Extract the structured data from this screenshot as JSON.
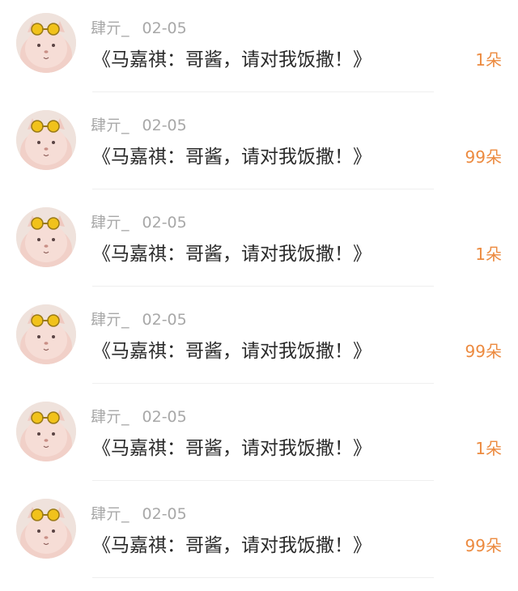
{
  "comments": [
    {
      "author": "肆亓_",
      "date": "02-05",
      "text": "《马嘉祺：哥酱，请对我饭撒！》",
      "flowers": "1朵",
      "avatar_icon": "cat-with-sunglasses-avatar"
    },
    {
      "author": "肆亓_",
      "date": "02-05",
      "text": "《马嘉祺：哥酱，请对我饭撒！》",
      "flowers": "99朵",
      "avatar_icon": "cat-with-sunglasses-avatar"
    },
    {
      "author": "肆亓_",
      "date": "02-05",
      "text": "《马嘉祺：哥酱，请对我饭撒！》",
      "flowers": "1朵",
      "avatar_icon": "cat-with-sunglasses-avatar"
    },
    {
      "author": "肆亓_",
      "date": "02-05",
      "text": "《马嘉祺：哥酱，请对我饭撒！》",
      "flowers": "99朵",
      "avatar_icon": "cat-with-sunglasses-avatar"
    },
    {
      "author": "肆亓_",
      "date": "02-05",
      "text": "《马嘉祺：哥酱，请对我饭撒！》",
      "flowers": "1朵",
      "avatar_icon": "cat-with-sunglasses-avatar"
    },
    {
      "author": "肆亓_",
      "date": "02-05",
      "text": "《马嘉祺：哥酱，请对我饭撒！》",
      "flowers": "99朵",
      "avatar_icon": "cat-with-sunglasses-avatar"
    }
  ],
  "colors": {
    "accent_count": "#ec8a3f",
    "meta_text": "#a8a8a8",
    "body_text": "#2a2a2a",
    "divider": "#efefef",
    "background": "#ffffff"
  }
}
